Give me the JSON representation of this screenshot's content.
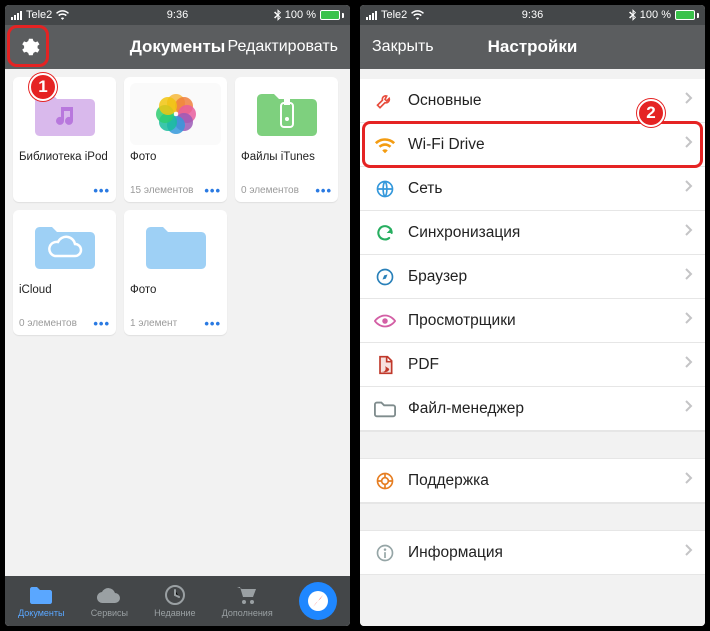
{
  "status": {
    "carrier": "Tele2",
    "time": "9:36",
    "battery_text": "100 %"
  },
  "screen1": {
    "title": "Документы",
    "edit": "Редактировать",
    "marker": "1",
    "tiles": [
      {
        "name": "Библиотека iPod",
        "meta": "",
        "type": "music"
      },
      {
        "name": "Фото",
        "meta": "15 элементов",
        "type": "photos"
      },
      {
        "name": "Файлы iTunes",
        "meta": "0 элементов",
        "type": "usb"
      },
      {
        "name": "iCloud",
        "meta": "0 элементов",
        "type": "icloud"
      },
      {
        "name": "Фото",
        "meta": "1 элемент",
        "type": "folder"
      }
    ],
    "tabs": [
      {
        "label": "Документы"
      },
      {
        "label": "Сервисы"
      },
      {
        "label": "Недавние"
      },
      {
        "label": "Дополнения"
      }
    ],
    "more_dots": "•••"
  },
  "screen2": {
    "close": "Закрыть",
    "title": "Настройки",
    "marker": "2",
    "items": [
      {
        "label": "Основные",
        "icon": "wrench",
        "color": "#e74c3c"
      },
      {
        "label": "Wi-Fi Drive",
        "icon": "wifi",
        "color": "#f39c12",
        "highlight": true
      },
      {
        "label": "Сеть",
        "icon": "globe",
        "color": "#3498db"
      },
      {
        "label": "Синхронизация",
        "icon": "sync",
        "color": "#27ae60"
      },
      {
        "label": "Браузер",
        "icon": "compass",
        "color": "#2980b9"
      },
      {
        "label": "Просмотрщики",
        "icon": "eye",
        "color": "#d35fa5"
      },
      {
        "label": "PDF",
        "icon": "pdf",
        "color": "#c0392b"
      },
      {
        "label": "Файл-менеджер",
        "icon": "folder",
        "color": "#7f8c8d"
      },
      {
        "label": "Поддержка",
        "icon": "support",
        "color": "#e67e22"
      },
      {
        "label": "Информация",
        "icon": "info",
        "color": "#95a5a6"
      }
    ]
  }
}
